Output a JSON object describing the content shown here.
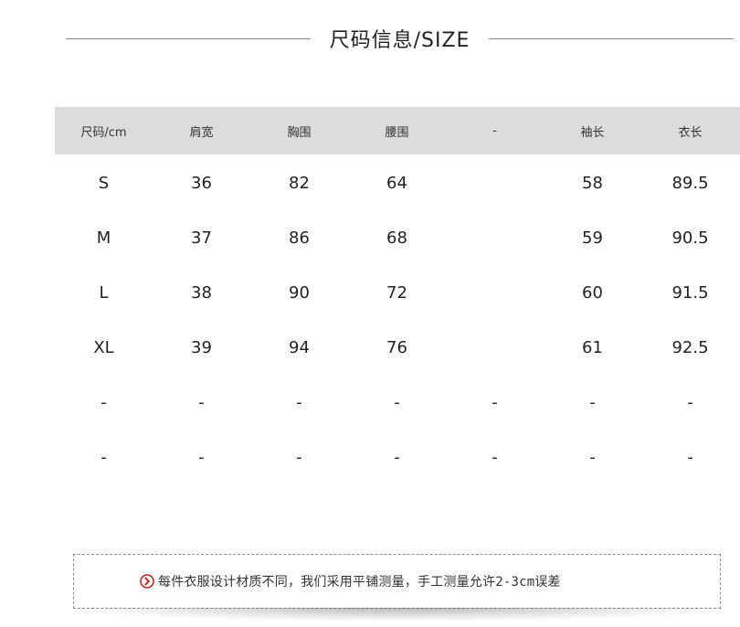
{
  "title": {
    "text": "尺码信息/SIZE"
  },
  "table": {
    "headers": [
      "尺码/cm",
      "肩宽",
      "胸围",
      "腰围",
      "-",
      "袖长",
      "衣长"
    ],
    "rows": [
      [
        "S",
        "36",
        "82",
        "64",
        "",
        "58",
        "89.5"
      ],
      [
        "M",
        "37",
        "86",
        "68",
        "",
        "59",
        "90.5"
      ],
      [
        "L",
        "38",
        "90",
        "72",
        "",
        "60",
        "91.5"
      ],
      [
        "XL",
        "39",
        "94",
        "76",
        "",
        "61",
        "92.5"
      ],
      [
        "-",
        "-",
        "-",
        "-",
        "-",
        "-",
        "-"
      ],
      [
        "-",
        "-",
        "-",
        "-",
        "-",
        "-",
        "-"
      ]
    ]
  },
  "note": {
    "icon": "chevron-right-circle-icon",
    "icon_color": "#d42020",
    "text": "每件衣服设计材质不同，我们采用平铺测量，手工测量允许2-3cm误差"
  },
  "colors": {
    "header_bg": "#dcdcdc",
    "title_line": "#8a8a8a"
  }
}
